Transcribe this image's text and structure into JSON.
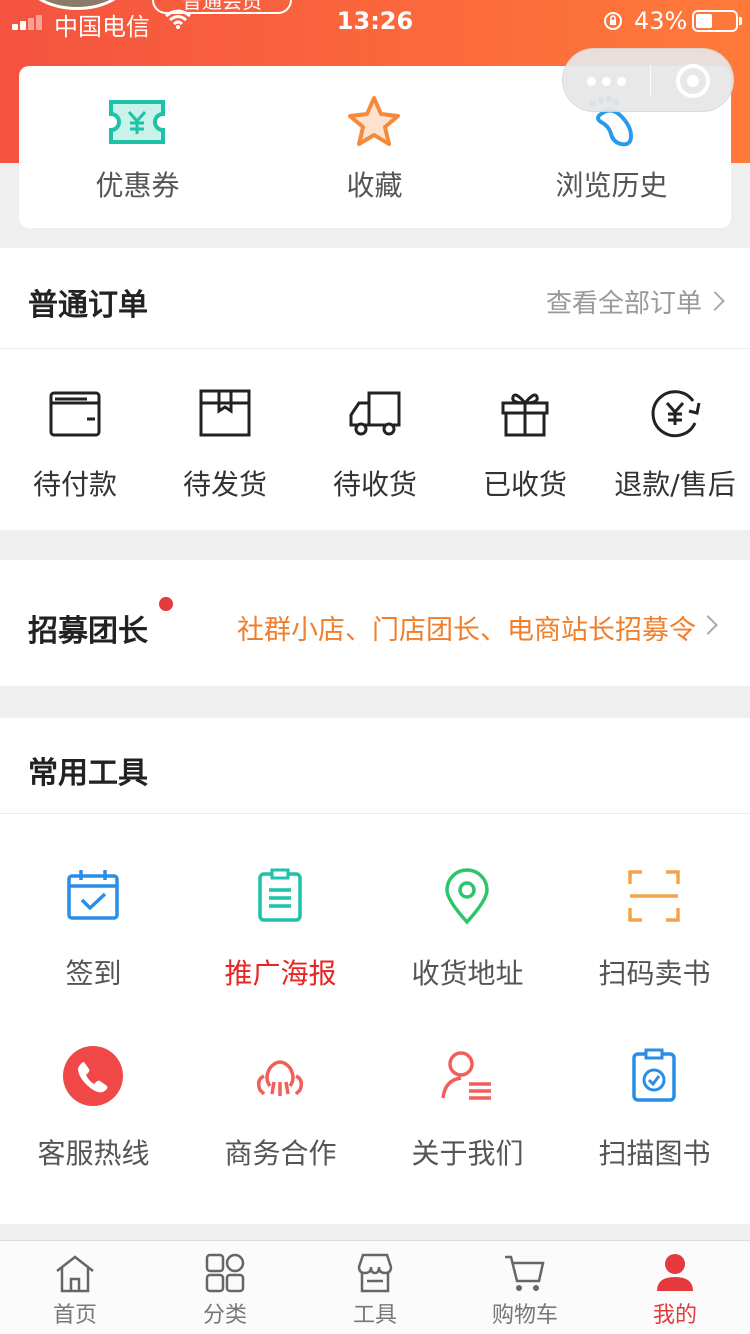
{
  "status_bar": {
    "carrier": "中国电信",
    "time": "13:26",
    "battery_percent": "43%"
  },
  "header": {
    "store_badge": "普通会员"
  },
  "quick_links": [
    {
      "label": "优惠券",
      "icon": "coupon-icon",
      "color": "#1fc1a8"
    },
    {
      "label": "收藏",
      "icon": "star-icon",
      "color": "#f58a3a"
    },
    {
      "label": "浏览历史",
      "icon": "footprint-icon",
      "color": "#2a9bea"
    }
  ],
  "orders": {
    "title": "普通订单",
    "more_label": "查看全部订单",
    "items": [
      {
        "label": "待付款",
        "icon": "wallet-icon"
      },
      {
        "label": "待发货",
        "icon": "package-icon"
      },
      {
        "label": "待收货",
        "icon": "truck-icon"
      },
      {
        "label": "已收货",
        "icon": "gift-icon"
      },
      {
        "label": "退款/售后",
        "icon": "refund-icon"
      }
    ]
  },
  "recruit": {
    "title": "招募团长",
    "description": "社群小店、门店团长、电商站长招募令",
    "accent": "#f07e2a",
    "dot_color": "#e5393e"
  },
  "tools": {
    "title": "常用工具",
    "items": [
      {
        "label": "签到",
        "icon": "calendar-check-icon",
        "color": "#2a8ee6"
      },
      {
        "label": "推广海报",
        "icon": "clipboard-icon",
        "color": "#1fc1a8",
        "highlight": true
      },
      {
        "label": "收货地址",
        "icon": "location-pin-icon",
        "color": "#2cc56a"
      },
      {
        "label": "扫码卖书",
        "icon": "scan-icon",
        "color": "#f5a34a"
      },
      {
        "label": "客服热线",
        "icon": "phone-icon",
        "color": "#f04747"
      },
      {
        "label": "商务合作",
        "icon": "handshake-icon",
        "color": "#f0605a"
      },
      {
        "label": "关于我们",
        "icon": "user-list-icon",
        "color": "#f0605a"
      },
      {
        "label": "扫描图书",
        "icon": "scan-book-icon",
        "color": "#2a8ee6"
      }
    ]
  },
  "tabbar": {
    "items": [
      {
        "label": "首页",
        "icon": "home-icon",
        "active": false
      },
      {
        "label": "分类",
        "icon": "category-icon",
        "active": false
      },
      {
        "label": "工具",
        "icon": "shop-icon",
        "active": false
      },
      {
        "label": "购物车",
        "icon": "cart-icon",
        "active": false
      },
      {
        "label": "我的",
        "icon": "profile-icon",
        "active": true
      }
    ],
    "active_color": "#e5393e"
  }
}
